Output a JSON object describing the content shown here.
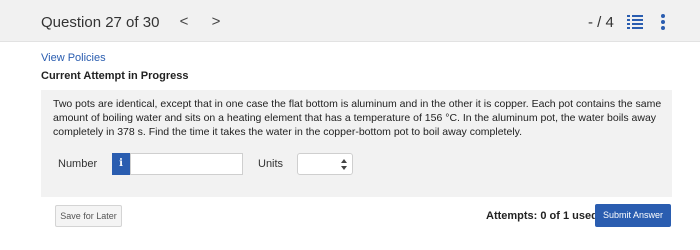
{
  "header": {
    "question_title": "Question 27 of 30",
    "prev_glyph": "<",
    "next_glyph": ">",
    "score": "- / 4"
  },
  "links": {
    "view_policies": "View Policies"
  },
  "status": {
    "attempt_status": "Current Attempt in Progress"
  },
  "question": {
    "text": "Two pots are identical, except that in one case the flat bottom is aluminum and in the other it is copper. Each pot contains the same amount of boiling water and sits on a heating element that has a temperature of 156 °C. In the aluminum pot, the water boils away completely in 378 s. Find the time it takes the water in the copper-bottom pot to boil away completely.",
    "number_label": "Number",
    "info_glyph": "i",
    "number_value": "",
    "units_label": "Units",
    "units_value": ""
  },
  "footer": {
    "save_label": "Save for Later",
    "attempts_text": "Attempts: 0 of 1 used",
    "submit_label": "Submit Answer"
  },
  "icons": {
    "list": "list-icon",
    "more": "more-vertical-icon",
    "info": "info-icon",
    "select_arrows": "select-arrows-icon"
  },
  "colors": {
    "accent": "#2a5db0",
    "header_bg": "#f1f1f1",
    "question_bg": "#f2f2f2"
  }
}
